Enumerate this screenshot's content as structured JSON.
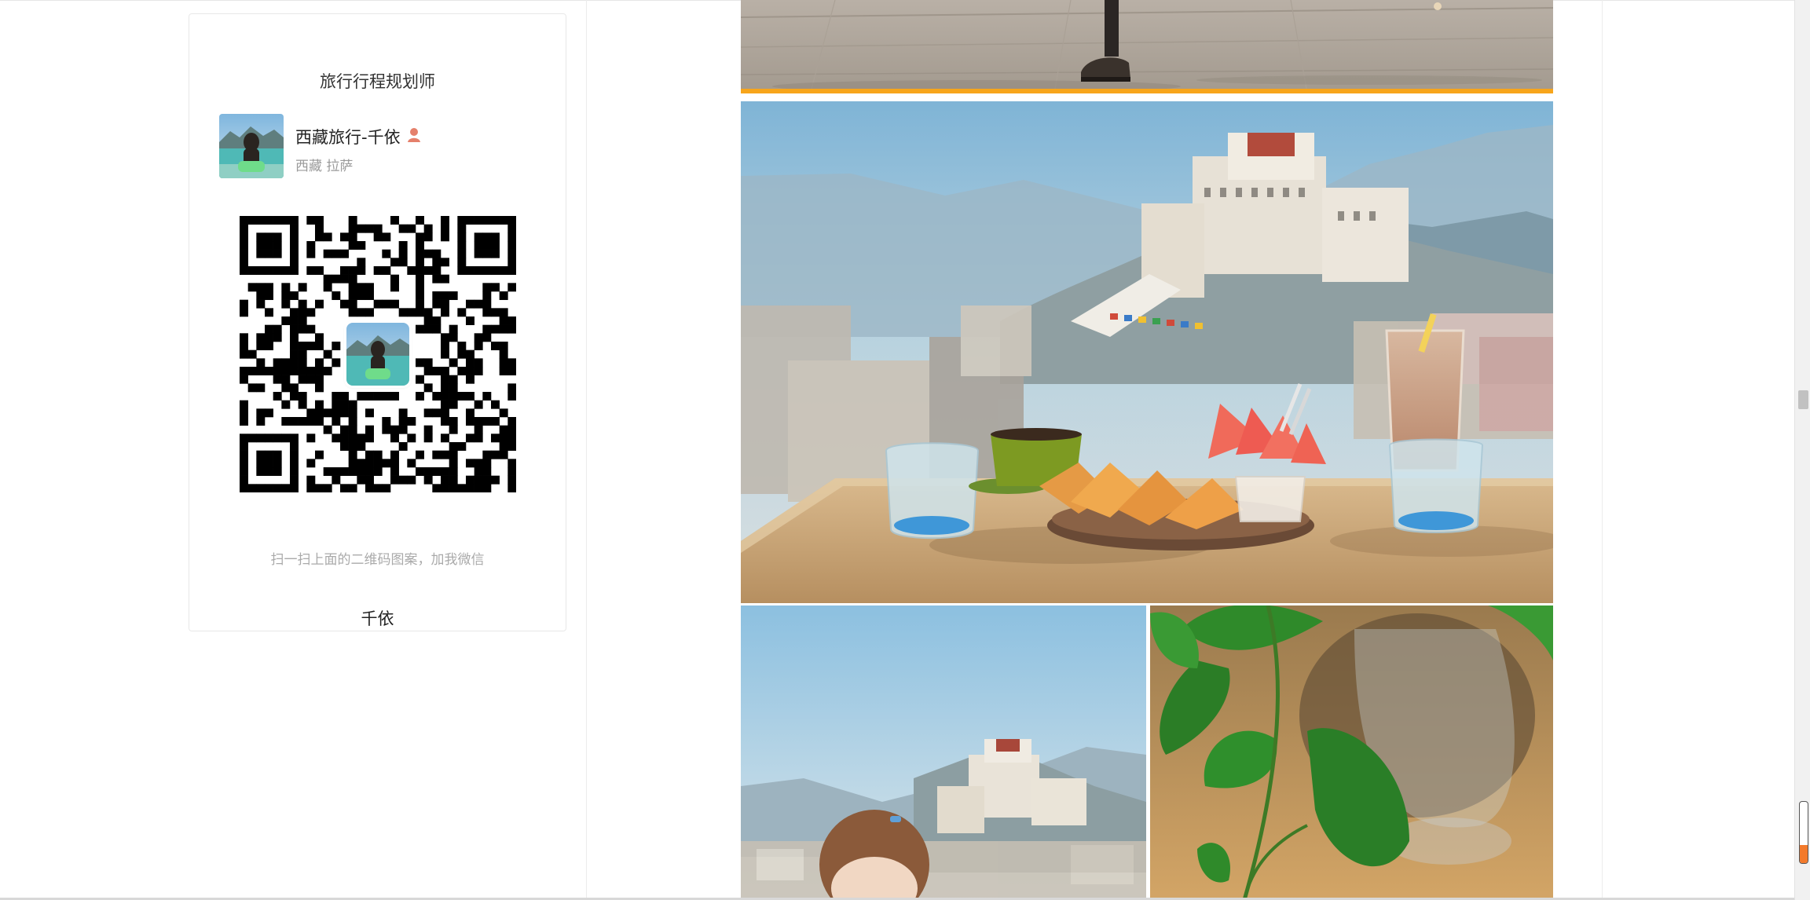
{
  "card": {
    "title": "旅行行程规划师",
    "profile_name": "西藏旅行-千依",
    "profile_location": "西藏 拉萨",
    "scan_hint": "扫一扫上面的二维码图案，加我微信",
    "footer_name": "千依"
  },
  "icons": {
    "name_badge": "person-emoji-icon",
    "avatar": "avatar-photo",
    "qr_code": "qr-code-icon"
  },
  "colors": {
    "accent_bar": "#f7a51b",
    "scroll_fill": "#f37a2b"
  },
  "scroll": {
    "mini_indicator_fill": 0.3
  }
}
